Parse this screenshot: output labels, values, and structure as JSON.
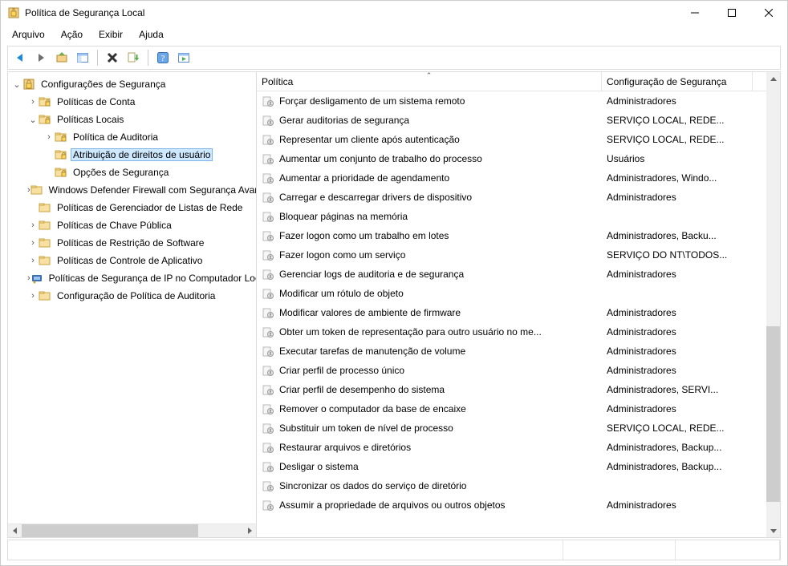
{
  "window": {
    "title": "Política de Segurança Local"
  },
  "menu": [
    "Arquivo",
    "Ação",
    "Exibir",
    "Ajuda"
  ],
  "tree": {
    "root": "Configurações de Segurança",
    "items": [
      {
        "label": "Políticas de Conta",
        "expander": "›",
        "indent": 1,
        "icon": "folder-lock"
      },
      {
        "label": "Políticas Locais",
        "expander": "⌄",
        "indent": 1,
        "icon": "folder-lock"
      },
      {
        "label": "Política de Auditoria",
        "expander": "›",
        "indent": 2,
        "icon": "folder-lock"
      },
      {
        "label": "Atribuição de direitos de usuário",
        "expander": "",
        "indent": 2,
        "icon": "folder-lock",
        "selected": true
      },
      {
        "label": "Opções de Segurança",
        "expander": "",
        "indent": 2,
        "icon": "folder-lock"
      },
      {
        "label": "Windows Defender Firewall com Segurança Avançada",
        "expander": "›",
        "indent": 1,
        "icon": "folder"
      },
      {
        "label": "Políticas de Gerenciador de Listas de Rede",
        "expander": "",
        "indent": 1,
        "icon": "folder"
      },
      {
        "label": "Políticas de Chave Pública",
        "expander": "›",
        "indent": 1,
        "icon": "folder"
      },
      {
        "label": "Políticas de Restrição de Software",
        "expander": "›",
        "indent": 1,
        "icon": "folder"
      },
      {
        "label": "Políticas de Controle de Aplicativo",
        "expander": "›",
        "indent": 1,
        "icon": "folder"
      },
      {
        "label": "Políticas de Segurança de IP no Computador Local",
        "expander": "›",
        "indent": 1,
        "icon": "ip"
      },
      {
        "label": "Configuração de Política de Auditoria",
        "expander": "›",
        "indent": 1,
        "icon": "folder"
      }
    ]
  },
  "columns": {
    "policy": "Política",
    "security": "Configuração de Segurança"
  },
  "rows": [
    {
      "policy": "Forçar desligamento de um sistema remoto",
      "security": "Administradores"
    },
    {
      "policy": "Gerar auditorias de segurança",
      "security": "SERVIÇO LOCAL, REDE..."
    },
    {
      "policy": "Representar um cliente após autenticação",
      "security": "SERVIÇO LOCAL, REDE..."
    },
    {
      "policy": "Aumentar um conjunto de trabalho do processo",
      "security": "Usuários"
    },
    {
      "policy": "Aumentar a prioridade de agendamento",
      "security": "Administradores, Windo..."
    },
    {
      "policy": "Carregar e descarregar drivers de dispositivo",
      "security": "Administradores"
    },
    {
      "policy": "Bloquear páginas na memória",
      "security": ""
    },
    {
      "policy": "Fazer logon como um trabalho em lotes",
      "security": "Administradores, Backu..."
    },
    {
      "policy": "Fazer logon como um serviço",
      "security": "SERVIÇO DO NT\\TODOS..."
    },
    {
      "policy": "Gerenciar logs de auditoria e de segurança",
      "security": "Administradores"
    },
    {
      "policy": "Modificar um rótulo de objeto",
      "security": ""
    },
    {
      "policy": "Modificar valores de ambiente de firmware",
      "security": "Administradores"
    },
    {
      "policy": "Obter um token de representação para outro usuário no me...",
      "security": "Administradores"
    },
    {
      "policy": "Executar tarefas de manutenção de volume",
      "security": "Administradores"
    },
    {
      "policy": "Criar perfil de processo único",
      "security": "Administradores"
    },
    {
      "policy": "Criar perfil de desempenho do sistema",
      "security": "Administradores, SERVI..."
    },
    {
      "policy": "Remover o computador da base de encaixe",
      "security": "Administradores"
    },
    {
      "policy": "Substituir um token de nível de processo",
      "security": "SERVIÇO LOCAL, REDE..."
    },
    {
      "policy": "Restaurar arquivos e diretórios",
      "security": "Administradores, Backup..."
    },
    {
      "policy": "Desligar o sistema",
      "security": "Administradores, Backup..."
    },
    {
      "policy": "Sincronizar os dados do serviço de diretório",
      "security": ""
    },
    {
      "policy": "Assumir a propriedade de arquivos ou outros objetos",
      "security": "Administradores"
    }
  ]
}
